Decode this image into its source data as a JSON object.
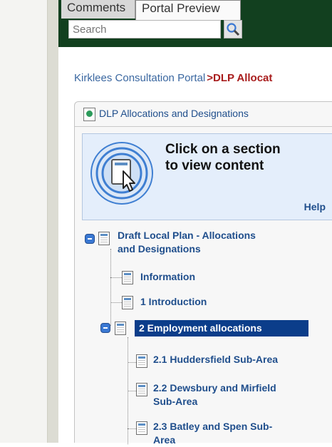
{
  "tabs": [
    {
      "label": "Comments"
    },
    {
      "label": "Portal Preview"
    }
  ],
  "search": {
    "placeholder": "Search",
    "icon": "magnifier-icon"
  },
  "breadcrumb": {
    "home_label": "Kirklees Consultation Portal",
    "separator": ">",
    "current_label": "DLP Allocat"
  },
  "panel": {
    "title": "DLP Allocations and Designations",
    "help_text_line1": "Click on a section",
    "help_text_line2": "to view content",
    "help_link": "Help"
  },
  "tree": {
    "root": {
      "label_line1": "Draft Local Plan - Allocations",
      "label_line2": "and Designations"
    },
    "items": [
      {
        "label": "Information"
      },
      {
        "label": "1 Introduction"
      },
      {
        "label": "2 Employment allocations",
        "selected": true
      }
    ],
    "children": [
      {
        "label_line1": "2.1 Huddersfield Sub-Area",
        "label_line2": ""
      },
      {
        "label_line1": "2.2 Dewsbury and Mirfield",
        "label_line2": "Sub-Area"
      },
      {
        "label_line1": "2.3 Batley and Spen Sub-",
        "label_line2": "Area"
      }
    ]
  },
  "colors": {
    "header_green": "#12401f",
    "link_blue": "#1f4e8c",
    "breadcrumb_red": "#a81c1c",
    "selected_bg": "#0b3d8a",
    "help_bg": "#e4eefb"
  }
}
